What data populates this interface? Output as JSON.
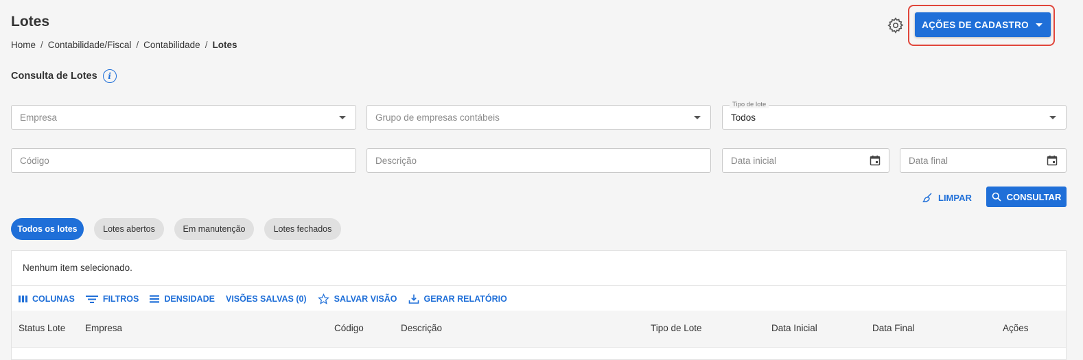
{
  "header": {
    "title": "Lotes",
    "breadcrumb": [
      "Home",
      "Contabilidade/Fiscal",
      "Contabilidade",
      "Lotes"
    ],
    "breadcrumb_separator": "/",
    "actions_button": "AÇÕES DE CADASTRO"
  },
  "section": {
    "title": "Consulta de Lotes",
    "info_glyph": "i"
  },
  "filters": {
    "empresa": {
      "placeholder": "Empresa"
    },
    "grupo": {
      "placeholder": "Grupo de empresas contábeis"
    },
    "tipo": {
      "legend": "Tipo de lote",
      "value": "Todos"
    },
    "codigo": {
      "placeholder": "Código"
    },
    "descricao": {
      "placeholder": "Descrição"
    },
    "data_inicial": {
      "placeholder": "Data inicial"
    },
    "data_final": {
      "placeholder": "Data final"
    }
  },
  "buttons": {
    "limpar": "LIMPAR",
    "consultar": "CONSULTAR"
  },
  "chips": [
    {
      "label": "Todos os lotes",
      "active": true
    },
    {
      "label": "Lotes abertos",
      "active": false
    },
    {
      "label": "Em manutenção",
      "active": false
    },
    {
      "label": "Lotes fechados",
      "active": false
    }
  ],
  "grid": {
    "selection_text": "Nenhum item selecionado.",
    "toolbar": {
      "colunas": "COLUNAS",
      "filtros": "FILTROS",
      "densidade": "DENSIDADE",
      "visoes_salvas": "VISÕES SALVAS (0)",
      "salvar_visao": "SALVAR VISÃO",
      "gerar_relatorio": "GERAR RELATÓRIO"
    },
    "columns": [
      "Status Lote",
      "Empresa",
      "Código",
      "Descrição",
      "Tipo de Lote",
      "Data Inicial",
      "Data Final",
      "Ações"
    ]
  },
  "colors": {
    "primary": "#1f6fd8",
    "highlight": "#e0453a",
    "background": "#f5f5f5"
  }
}
